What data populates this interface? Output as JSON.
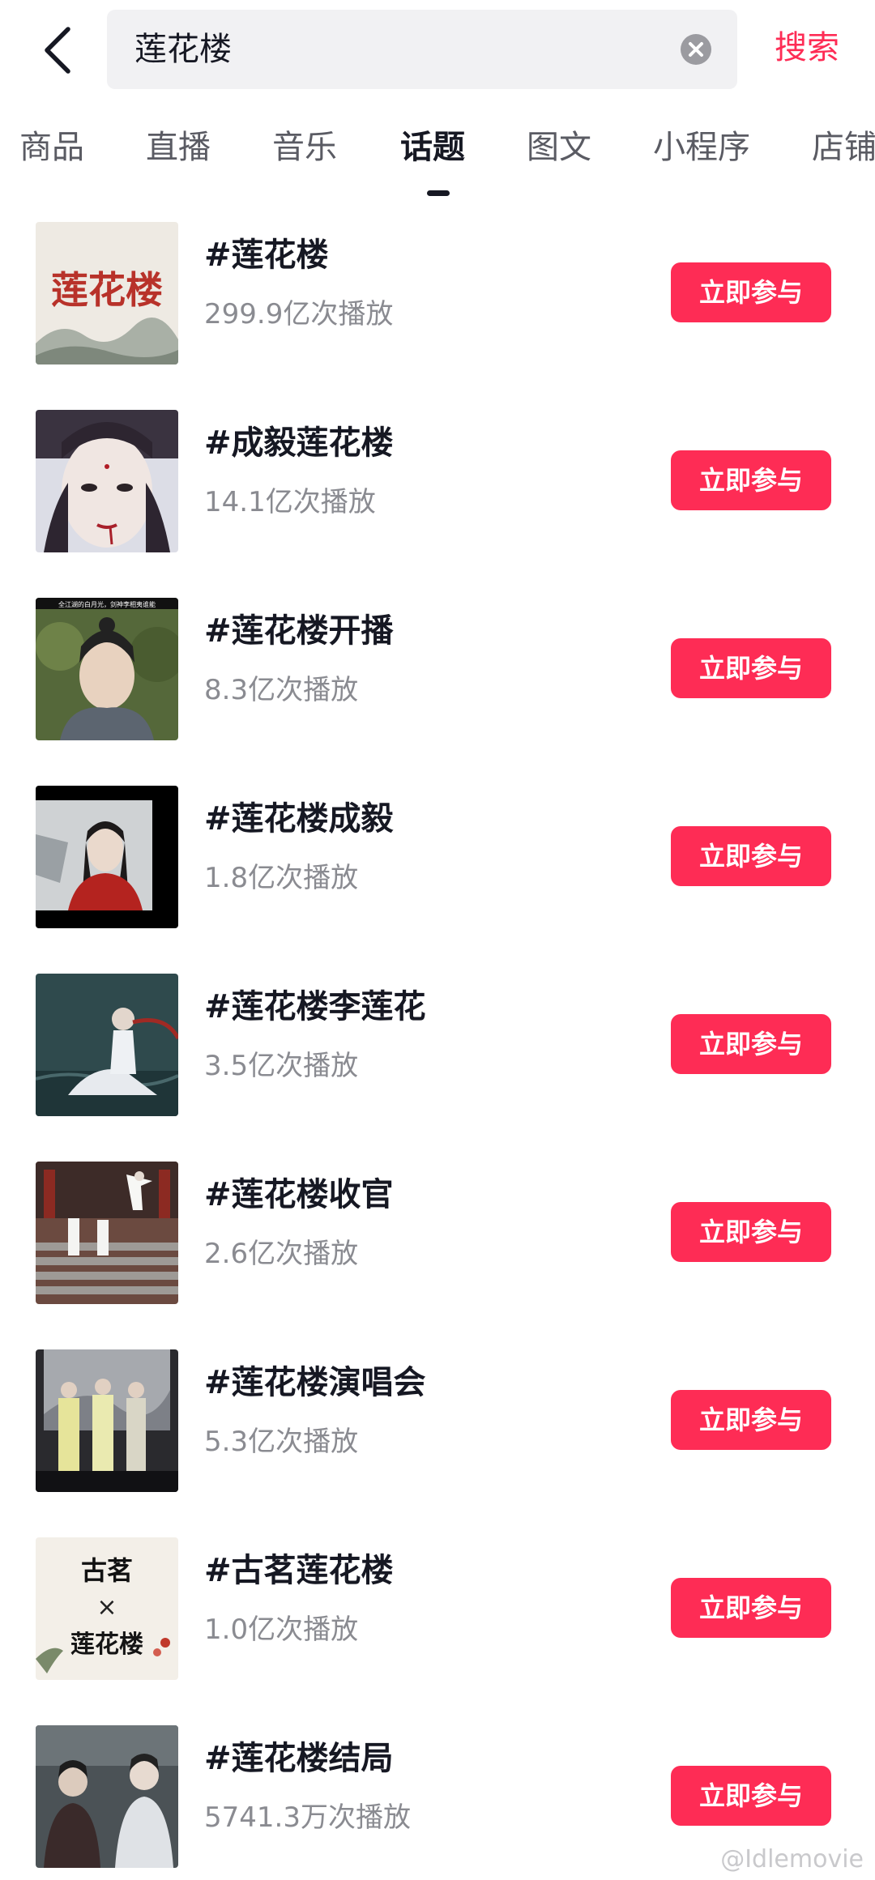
{
  "search": {
    "query": "莲花楼",
    "action_label": "搜索"
  },
  "tabs": [
    {
      "label": "商品"
    },
    {
      "label": "直播"
    },
    {
      "label": "音乐"
    },
    {
      "label": "话题"
    },
    {
      "label": "图文"
    },
    {
      "label": "小程序"
    },
    {
      "label": "店铺"
    }
  ],
  "active_tab": "话题",
  "join_label": "立即参与",
  "topics": [
    {
      "name": "#莲花楼",
      "views": "299.9亿次播放"
    },
    {
      "name": "#成毅莲花楼",
      "views": "14.1亿次播放"
    },
    {
      "name": "#莲花楼开播",
      "views": "8.3亿次播放"
    },
    {
      "name": "#莲花楼成毅",
      "views": "1.8亿次播放"
    },
    {
      "name": "#莲花楼李莲花",
      "views": "3.5亿次播放"
    },
    {
      "name": "#莲花楼收官",
      "views": "2.6亿次播放"
    },
    {
      "name": "#莲花楼演唱会",
      "views": "5.3亿次播放"
    },
    {
      "name": "#古茗莲花楼",
      "views": "1.0亿次播放"
    },
    {
      "name": "#莲花楼结局",
      "views": "5741.3万次播放"
    }
  ],
  "thumb_text": {
    "calligraphy": "莲花楼",
    "brand": "古茗",
    "cross": "×",
    "caption": "全江湖的白月光，剑神李相夷谁能"
  },
  "watermark": "@Idlemovie",
  "colors": {
    "accent": "#fe2c55",
    "text_primary": "#161823",
    "text_secondary": "#8a8b91"
  }
}
